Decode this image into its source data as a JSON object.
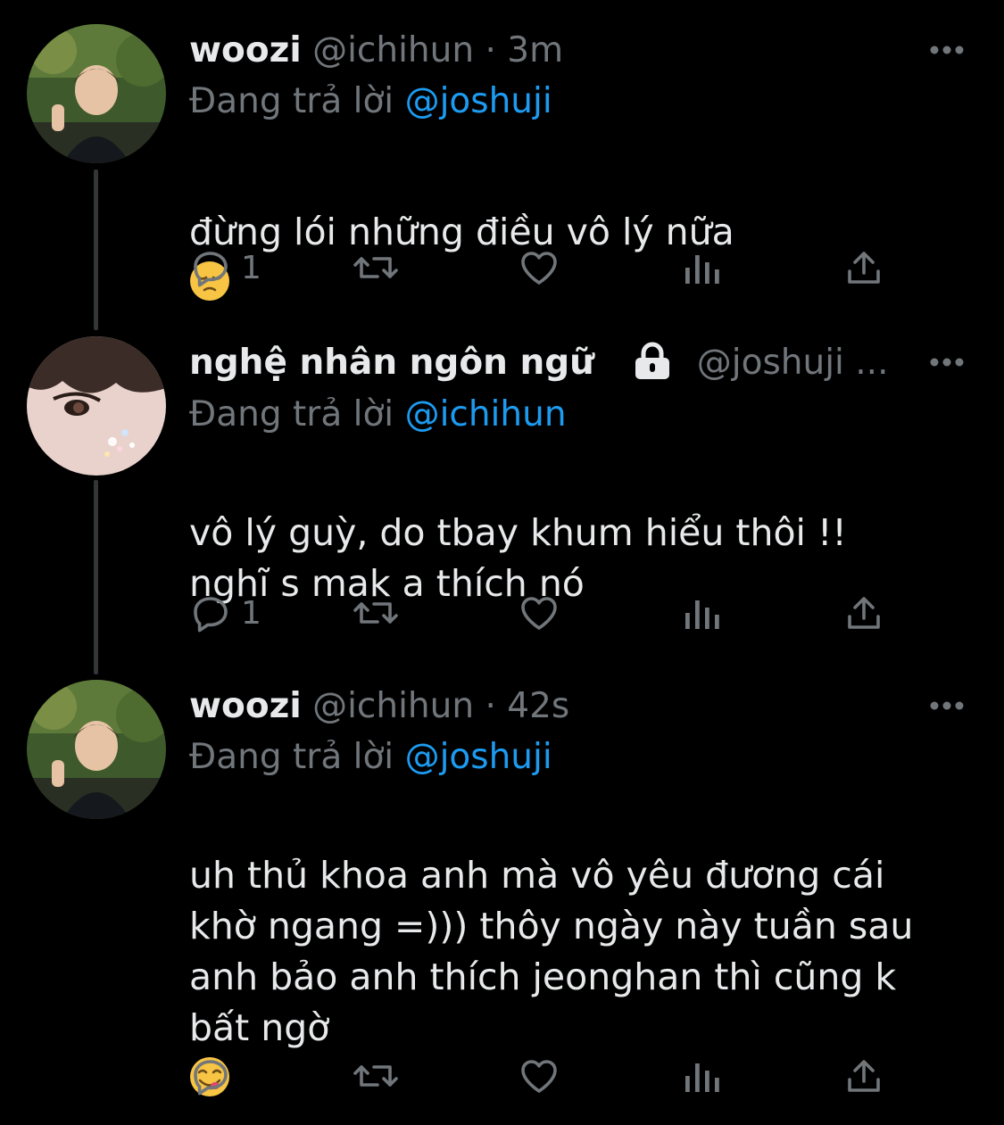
{
  "tweets": [
    {
      "display_name": "woozi",
      "handle": "@ichihun",
      "separator": "·",
      "timestamp": "3m",
      "locked": false,
      "reply_prefix": "Đang trả lời",
      "reply_to": "@joshuji",
      "text": "đừng lói những điều vô lý nữa",
      "emoji": "pensive-face",
      "reply_count": "1",
      "avatar": "avatar-woozi"
    },
    {
      "display_name": "nghệ nhân ngôn ngữ",
      "handle": "@joshuji ...",
      "locked": true,
      "reply_prefix": "Đang trả lời",
      "reply_to": "@ichihun",
      "text": "vô lý guỳ, do tbay khum hiểu thôi !!\nnghĩ s mak a thích nó",
      "reply_count": "1",
      "avatar": "avatar-joshuji"
    },
    {
      "display_name": "woozi",
      "handle": "@ichihun",
      "separator": "·",
      "timestamp": "42s",
      "locked": false,
      "reply_prefix": "Đang trả lời",
      "reply_to": "@joshuji",
      "text": "uh thủ khoa anh mà vô yêu đương cái\nkhờ ngang =))) thôy ngày này tuần sau\nanh bảo anh thích jeonghan thì cũng k\nbất ngờ",
      "emoji": "face-savoring-food",
      "reply_count": "",
      "avatar": "avatar-woozi"
    }
  ],
  "icons": {
    "reply": "reply-icon",
    "retweet": "retweet-icon",
    "like": "heart-icon",
    "analytics": "analytics-icon",
    "share": "share-icon",
    "more": "more-icon",
    "lock": "lock-icon"
  },
  "colors": {
    "background": "#000000",
    "text_primary": "#e7e9ea",
    "text_secondary": "#71767b",
    "accent": "#1d9bf0",
    "thread_line": "#333639"
  }
}
